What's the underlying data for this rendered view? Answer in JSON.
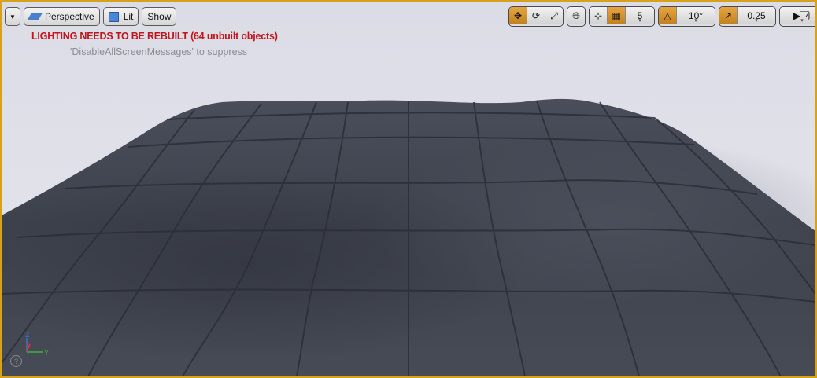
{
  "toolbar_left": {
    "menu_icon": "chevron-down-icon",
    "perspective_label": "Perspective",
    "lit_label": "Lit",
    "show_label": "Show"
  },
  "toolbar_right": {
    "grid_snap_value": "5",
    "rotation_snap_value": "10°",
    "scale_snap_value": "0.25",
    "camera_speed_value": "4"
  },
  "messages": {
    "lighting_warning": "LIGHTING NEEDS TO BE REBUILT (64 unbuilt objects)",
    "suppress_hint": "'DisableAllScreenMessages' to suppress"
  },
  "axis_gizmo": {
    "z": "Z",
    "x": "X",
    "y": "Y"
  },
  "colors": {
    "viewport_border": "#d6a21a",
    "active_button": "#d08f28",
    "warning_text": "#c3141a",
    "terrain": "#3d414c"
  }
}
